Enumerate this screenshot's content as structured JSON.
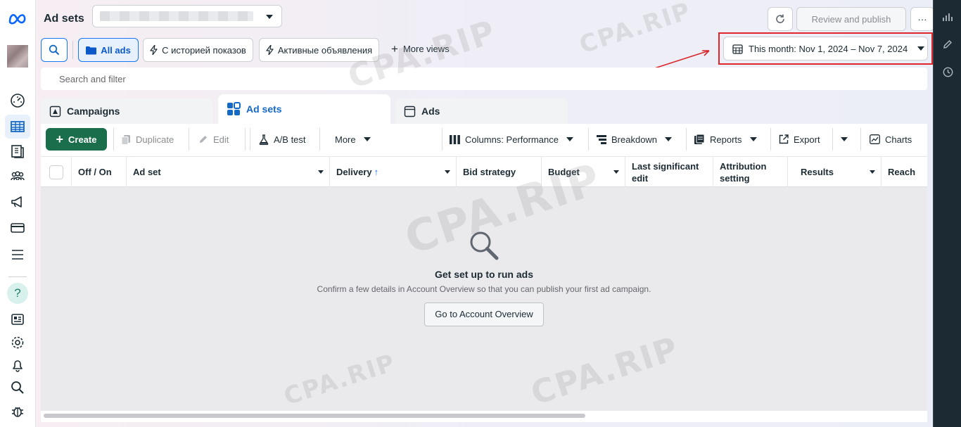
{
  "header": {
    "title": "Ad sets",
    "review_label": "Review and publish",
    "more_label": "···"
  },
  "filters": {
    "all_ads": "All ads",
    "view_history": "С историей показов",
    "view_active": "Активные объявления",
    "more_views": "More views",
    "date_range": "This month: Nov 1, 2024 – Nov 7, 2024",
    "search_placeholder": "Search and filter"
  },
  "tabs": [
    {
      "label": "Campaigns"
    },
    {
      "label": "Ad sets"
    },
    {
      "label": "Ads"
    }
  ],
  "toolbar": {
    "create": "Create",
    "duplicate": "Duplicate",
    "edit": "Edit",
    "ab_test": "A/B test",
    "more": "More",
    "columns": "Columns: Performance",
    "breakdown": "Breakdown",
    "reports": "Reports",
    "export": "Export",
    "charts": "Charts"
  },
  "table": {
    "columns": [
      "Off / On",
      "Ad set",
      "Delivery",
      "Bid strategy",
      "Budget",
      "Last significant edit",
      "Attribution setting",
      "Results",
      "Reach"
    ],
    "delivery_sort": "↑"
  },
  "empty_state": {
    "heading": "Get set up to run ads",
    "subtext": "Confirm a few details in Account Overview so that you can publish your first ad campaign.",
    "button": "Go to Account Overview"
  },
  "watermark": "CPA.RIP",
  "colors": {
    "accent_blue": "#1877f2",
    "create_green": "#1b6e4b",
    "highlight_red": "#e0262a",
    "right_rail": "#1c2b33"
  },
  "icons": {
    "left_rail": [
      "meta-logo",
      "dashboard-icon",
      "table-icon",
      "pages-icon",
      "audience-icon",
      "megaphone-icon",
      "billing-icon",
      "menu-icon",
      "help-icon",
      "news-icon",
      "settings-icon",
      "bell-icon",
      "search-icon",
      "bug-icon"
    ],
    "right_rail": [
      "bar-chart-icon",
      "pencil-icon",
      "clock-icon"
    ]
  }
}
